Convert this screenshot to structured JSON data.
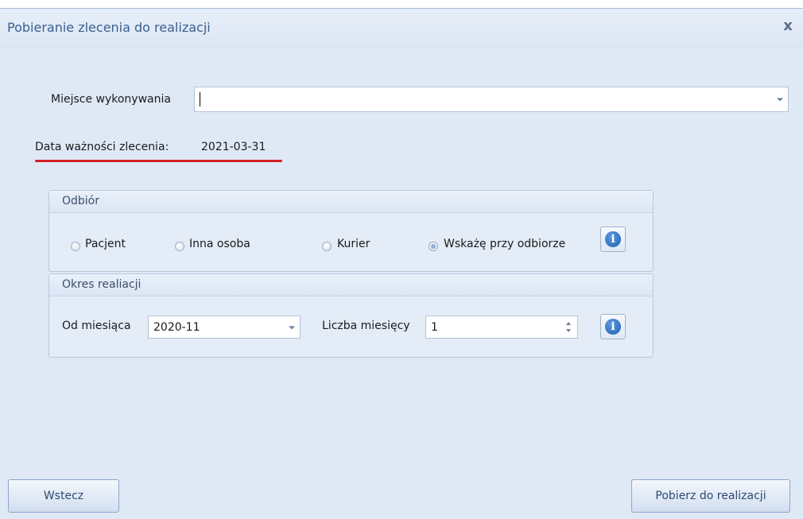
{
  "window": {
    "title": "Pobieranie zlecenia do realizacji",
    "close_glyph": "x"
  },
  "place": {
    "label": "Miejsce wykonywania",
    "value": ""
  },
  "validity": {
    "label": "Data ważności zlecenia:",
    "value": "2021-03-31",
    "highlight_color": "#d21f24"
  },
  "pickup": {
    "title": "Odbiór",
    "options": [
      {
        "label": "Pacjent",
        "checked": false
      },
      {
        "label": "Inna osoba",
        "checked": false
      },
      {
        "label": "Kurier",
        "checked": false
      },
      {
        "label": "Wskażę przy odbiorze",
        "checked": true
      }
    ],
    "info_icon": "info-icon"
  },
  "period": {
    "title": "Okres realiacji",
    "from_label": "Od miesiąca",
    "from_value": "2020-11",
    "count_label": "Liczba miesięcy",
    "count_value": "1",
    "info_icon": "info-icon"
  },
  "buttons": {
    "back": "Wstecz",
    "fetch": "Pobierz do realizacji"
  }
}
